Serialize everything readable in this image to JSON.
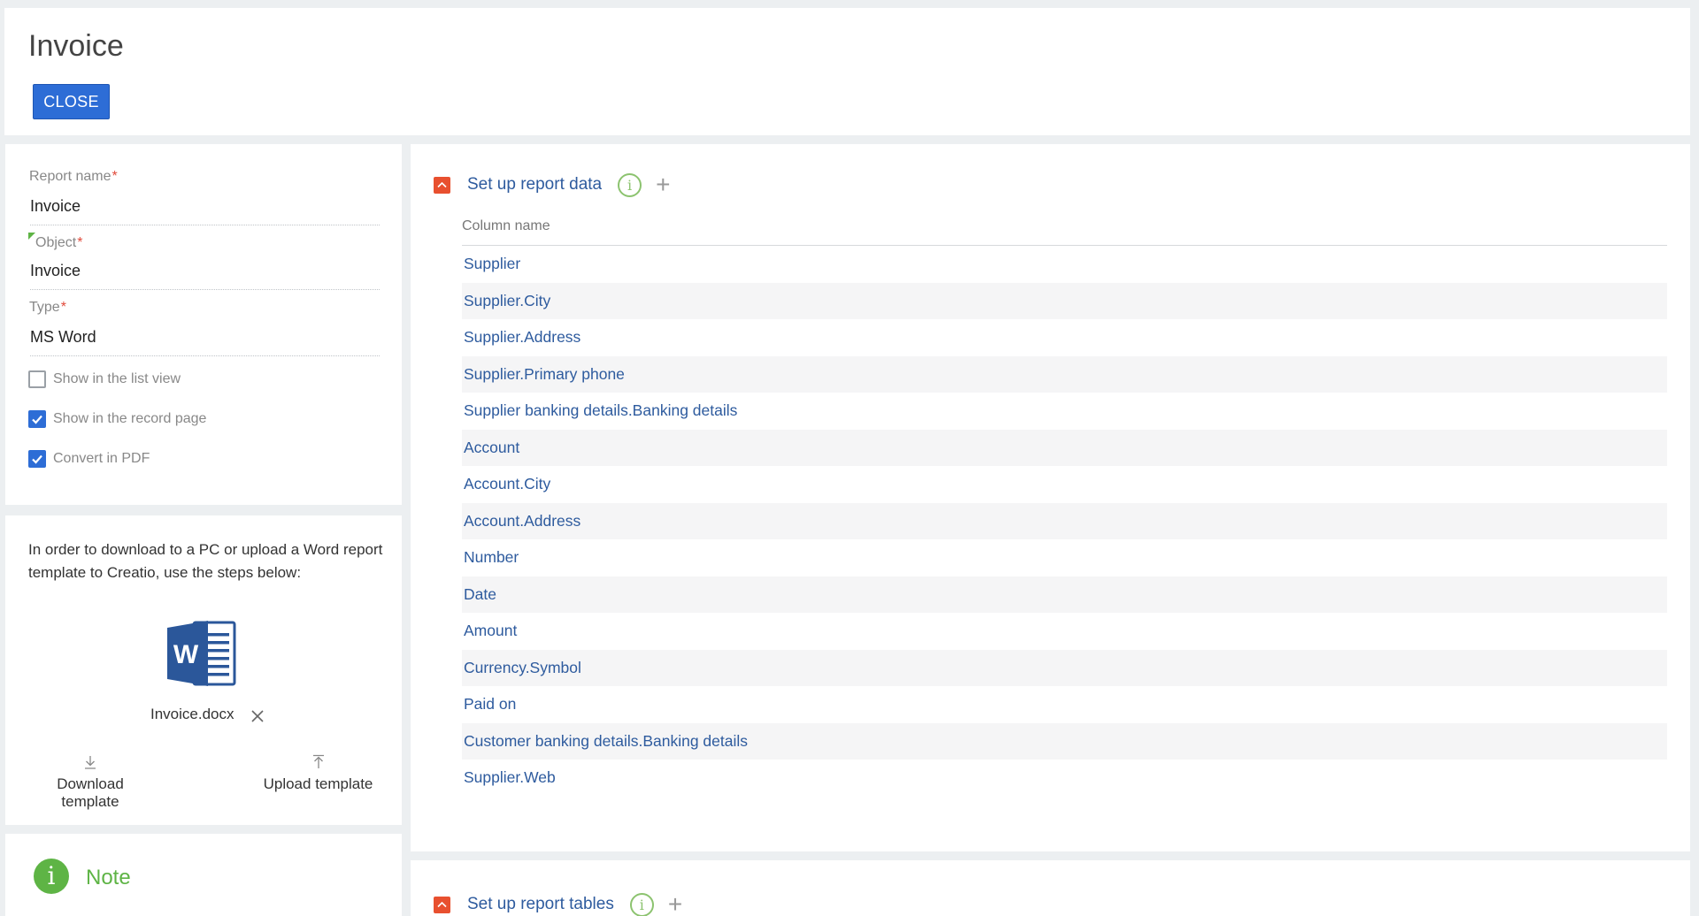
{
  "header": {
    "title": "Invoice",
    "close_label": "CLOSE"
  },
  "form": {
    "report_name_label": "Report name",
    "report_name_value": "Invoice",
    "object_label": "Object",
    "object_value": "Invoice",
    "type_label": "Type",
    "type_value": "MS Word",
    "required_mark": "*",
    "checkboxes": [
      {
        "label": "Show in the list view",
        "checked": false
      },
      {
        "label": "Show in the record page",
        "checked": true
      },
      {
        "label": "Convert in PDF",
        "checked": true
      }
    ]
  },
  "template": {
    "info": "In order to download to a PC or upload a Word report template to Creatio, use the steps below:",
    "filename": "Invoice.docx",
    "download_label": "Download template",
    "upload_label": "Upload template",
    "icon": "word-document-icon"
  },
  "note": {
    "title": "Note",
    "icon_glyph": "i"
  },
  "report_data": {
    "title": "Set up report data",
    "info_glyph": "i",
    "column_header": "Column name",
    "columns": [
      "Supplier",
      "Supplier.City",
      "Supplier.Address",
      "Supplier.Primary phone",
      "Supplier banking details.Banking details",
      "Account",
      "Account.City",
      "Account.Address",
      "Number",
      "Date",
      "Amount",
      "Currency.Symbol",
      "Paid on",
      "Customer banking details.Banking details",
      "Supplier.Web"
    ]
  },
  "report_tables": {
    "title": "Set up report tables",
    "info_glyph": "i"
  },
  "colors": {
    "accent": "#2d6dd6",
    "link": "#2e5b9e",
    "collapse": "#e8502f",
    "success": "#5eb445",
    "required": "#e14a3b"
  }
}
